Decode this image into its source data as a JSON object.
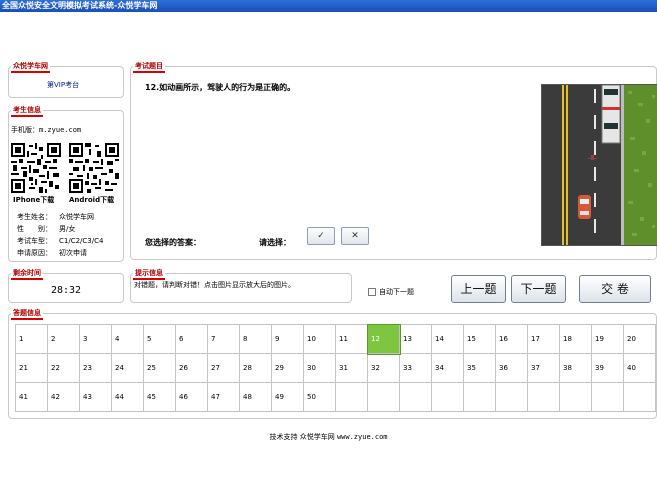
{
  "window": {
    "title": "全国众悦安全文明模拟考试系统-众悦学车网"
  },
  "school": {
    "title": "众悦学车网",
    "exam_room": "第VIP考台"
  },
  "candidate": {
    "title": "考生信息",
    "site": "手机版：m.zyue.com",
    "iphone_label": "IPhone下载",
    "android_label": "Android下载",
    "fields": [
      {
        "key": "考生姓名：",
        "value": "众悦学车网"
      },
      {
        "key": "性　　别：",
        "value": "男/女"
      },
      {
        "key": "考试车型：",
        "value": "C1/C2/C3/C4"
      },
      {
        "key": "申请原因：",
        "value": "初次申请"
      }
    ]
  },
  "question": {
    "title": "考试题目",
    "text": "12.如动画所示，驾驶人的行为是正确的。",
    "your_answer_label": "您选择的答案：",
    "choose_label": "请选择：",
    "correct_symbol": "✓",
    "wrong_symbol": "✕"
  },
  "timer": {
    "title": "剩余时间",
    "value": "28:32"
  },
  "hint": {
    "title": "提示信息",
    "text": "对错题，请判断对错！点击图片显示放大后的图片。"
  },
  "auto_next": {
    "label": "自动下一题",
    "checked": false
  },
  "nav": {
    "prev": "上一题",
    "next": "下一题",
    "submit": "交 卷"
  },
  "answers": {
    "title": "答题信息",
    "current": 12,
    "rows": [
      [
        "1",
        "2",
        "3",
        "4",
        "5",
        "6",
        "7",
        "8",
        "9",
        "10",
        "11",
        "12",
        "13",
        "14",
        "15",
        "16",
        "17",
        "18",
        "19",
        "20"
      ],
      [
        "21",
        "22",
        "23",
        "24",
        "25",
        "26",
        "27",
        "28",
        "29",
        "30",
        "31",
        "32",
        "33",
        "34",
        "35",
        "36",
        "37",
        "38",
        "39",
        "40"
      ],
      [
        "41",
        "42",
        "43",
        "44",
        "45",
        "46",
        "47",
        "48",
        "49",
        "50",
        "",
        "",
        "",
        "",
        "",
        "",
        "",
        "",
        "",
        ""
      ]
    ]
  },
  "footer": {
    "label": "技术支持 众悦学车网",
    "url": "www.zyue.com"
  },
  "colors": {
    "title_bar": "#1a4fb8",
    "section_title": "#b00000",
    "current_cell": "#7ec540"
  }
}
